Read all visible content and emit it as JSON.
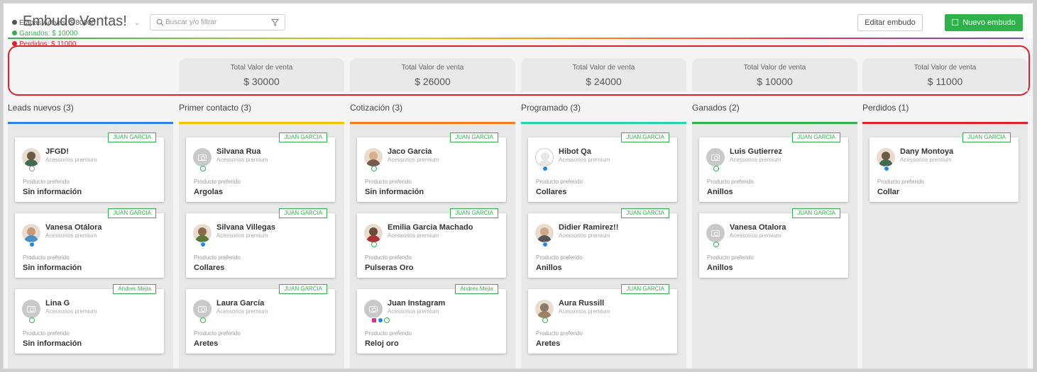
{
  "header": {
    "title": "Embudo Ventas!",
    "search_placeholder": "Buscar y/o filtrar",
    "edit_label": "Editar embudo",
    "new_label": "Nuevo embudo"
  },
  "summary": {
    "active": "Etapas Activas: $ 80000",
    "won": "Ganados: $ 10000",
    "lost": "Perdidos: $ 11000",
    "totals": [
      {
        "label": "Total Valor de venta",
        "value": "$ 30000"
      },
      {
        "label": "Total Valor de venta",
        "value": "$ 26000"
      },
      {
        "label": "Total Valor de venta",
        "value": "$ 24000"
      },
      {
        "label": "Total Valor de venta",
        "value": "$ 10000"
      },
      {
        "label": "Total Valor de venta",
        "value": "$ 11000"
      }
    ]
  },
  "colors": {
    "leads": "#2f80ed",
    "contacto": "#f2c400",
    "cotizacion": "#ff7a1a",
    "programado": "#27d3a8",
    "ganados": "#2fb24a",
    "perdidos": "#e0212b",
    "accent": "#2fb24a"
  },
  "product_label": "Producto preferido",
  "columns": [
    {
      "title": "Leads nuevos (3)",
      "cards": [
        {
          "tag": "JUAN GARCIA",
          "name": "JFGD!",
          "subtitle": "Acessorios premium",
          "product": "Sin información",
          "avatar": "photo",
          "channels": [
            "gray"
          ]
        },
        {
          "tag": "JUAN GARCIA",
          "name": "Vanesa Otálora",
          "subtitle": "Acessorios premium",
          "product": "Sin información",
          "avatar": "photo",
          "channels": [
            "messenger"
          ]
        },
        {
          "tag": "Andres Mejia",
          "name": "Lina G",
          "subtitle": "Acessorios premium",
          "product": "Sin información",
          "avatar": "camera",
          "channels": [
            "whatsapp"
          ]
        }
      ]
    },
    {
      "title": "Primer contacto (3)",
      "cards": [
        {
          "tag": "JUAN GARCIA",
          "name": "Silvana Rua",
          "subtitle": "Acessorios premium",
          "product": "Argolas",
          "avatar": "camera",
          "channels": [
            "whatsapp"
          ]
        },
        {
          "tag": "JUAN GARCIA",
          "name": "Silvana Villegas",
          "subtitle": "Acessorios premium",
          "product": "Collares",
          "avatar": "photo",
          "channels": [
            "messenger"
          ]
        },
        {
          "tag": "JUAN GARCIA",
          "name": "Laura García",
          "subtitle": "Acessorios premium",
          "product": "Aretes",
          "avatar": "camera",
          "channels": [
            "whatsapp"
          ]
        }
      ]
    },
    {
      "title": "Cotización (3)",
      "cards": [
        {
          "tag": "JUAN GARCIA",
          "name": "Jaco Garcia",
          "subtitle": "Acessorios premium",
          "product": "Sin información",
          "avatar": "photo",
          "channels": [
            "whatsapp"
          ]
        },
        {
          "tag": "JUAN GARCIA",
          "name": "Emilia Garcia Machado",
          "subtitle": "Acessorios premium",
          "product": "Pulseras Oro",
          "avatar": "photo",
          "channels": [
            "whatsapp"
          ]
        },
        {
          "tag": "Andres Mejia",
          "name": "Juan Instagram",
          "subtitle": "Acessorios premium",
          "product": "Reloj oro",
          "avatar": "camera",
          "channels": [
            "instagram",
            "messenger",
            "whatsapp"
          ]
        }
      ]
    },
    {
      "title": "Programado (3)",
      "cards": [
        {
          "tag": "JUAN GARCIA",
          "name": "Hibot Qa",
          "subtitle": "Acessorios premium",
          "product": "Collares",
          "avatar": "blank",
          "channels": [
            "messenger"
          ]
        },
        {
          "tag": "JUAN GARCIA",
          "name": "Didier Ramirez!!",
          "subtitle": "Acessorios premium",
          "product": "Anillos",
          "avatar": "photo",
          "channels": [
            "messenger"
          ]
        },
        {
          "tag": "JUAN GARCIA",
          "name": "Aura Russill",
          "subtitle": "Acessorios premium",
          "product": "Aretes",
          "avatar": "photo",
          "channels": [
            "whatsapp"
          ]
        }
      ]
    },
    {
      "title": "Ganados (2)",
      "cards": [
        {
          "tag": "JUAN GARCIA",
          "name": "Luis Gutierrez",
          "subtitle": "Acessorios premium",
          "product": "Anillos",
          "avatar": "camera",
          "channels": [
            "whatsapp"
          ]
        },
        {
          "tag": "JUAN GARCIA",
          "name": "Vanesa Otalora",
          "subtitle": "Acessorios premium",
          "product": "Anillos",
          "avatar": "camera",
          "channels": [
            "whatsapp"
          ]
        }
      ]
    },
    {
      "title": "Perdidos (1)",
      "cards": [
        {
          "tag": "JUAN GARCIA",
          "name": "Dany Montoya",
          "subtitle": "Acessorios premium",
          "product": "Collar",
          "avatar": "photo",
          "channels": [
            "messenger"
          ]
        }
      ]
    }
  ]
}
